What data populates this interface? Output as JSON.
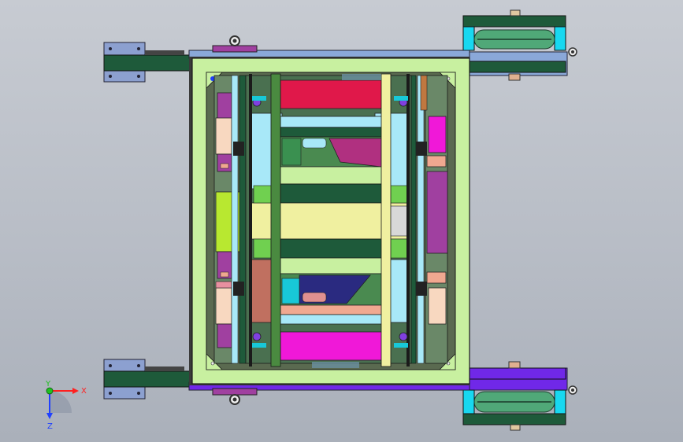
{
  "viewport": {
    "triad": {
      "x_label": "X",
      "y_label": "Y",
      "z_label": "Z",
      "colors": {
        "x": "#ff2020",
        "y": "#20c020",
        "z": "#2040ff"
      }
    }
  },
  "model_colors": {
    "outer_frame": "#c8f0a0",
    "frame_edge": "#1a1a1a",
    "dark_green": "#1e5a3a",
    "crimson": "#e0184a",
    "magenta": "#f018d8",
    "light_cyan": "#a8e8f8",
    "lime": "#b8e830",
    "pale_yellow": "#f0f0a0",
    "purple": "#a040a0",
    "salmon": "#f0a890",
    "blue_plate": "#8aa8d8",
    "violet_plate": "#7028e8",
    "bracket": "#8ca0d0",
    "wheel": "#50a878",
    "cyan_block": "#18d8f0"
  }
}
